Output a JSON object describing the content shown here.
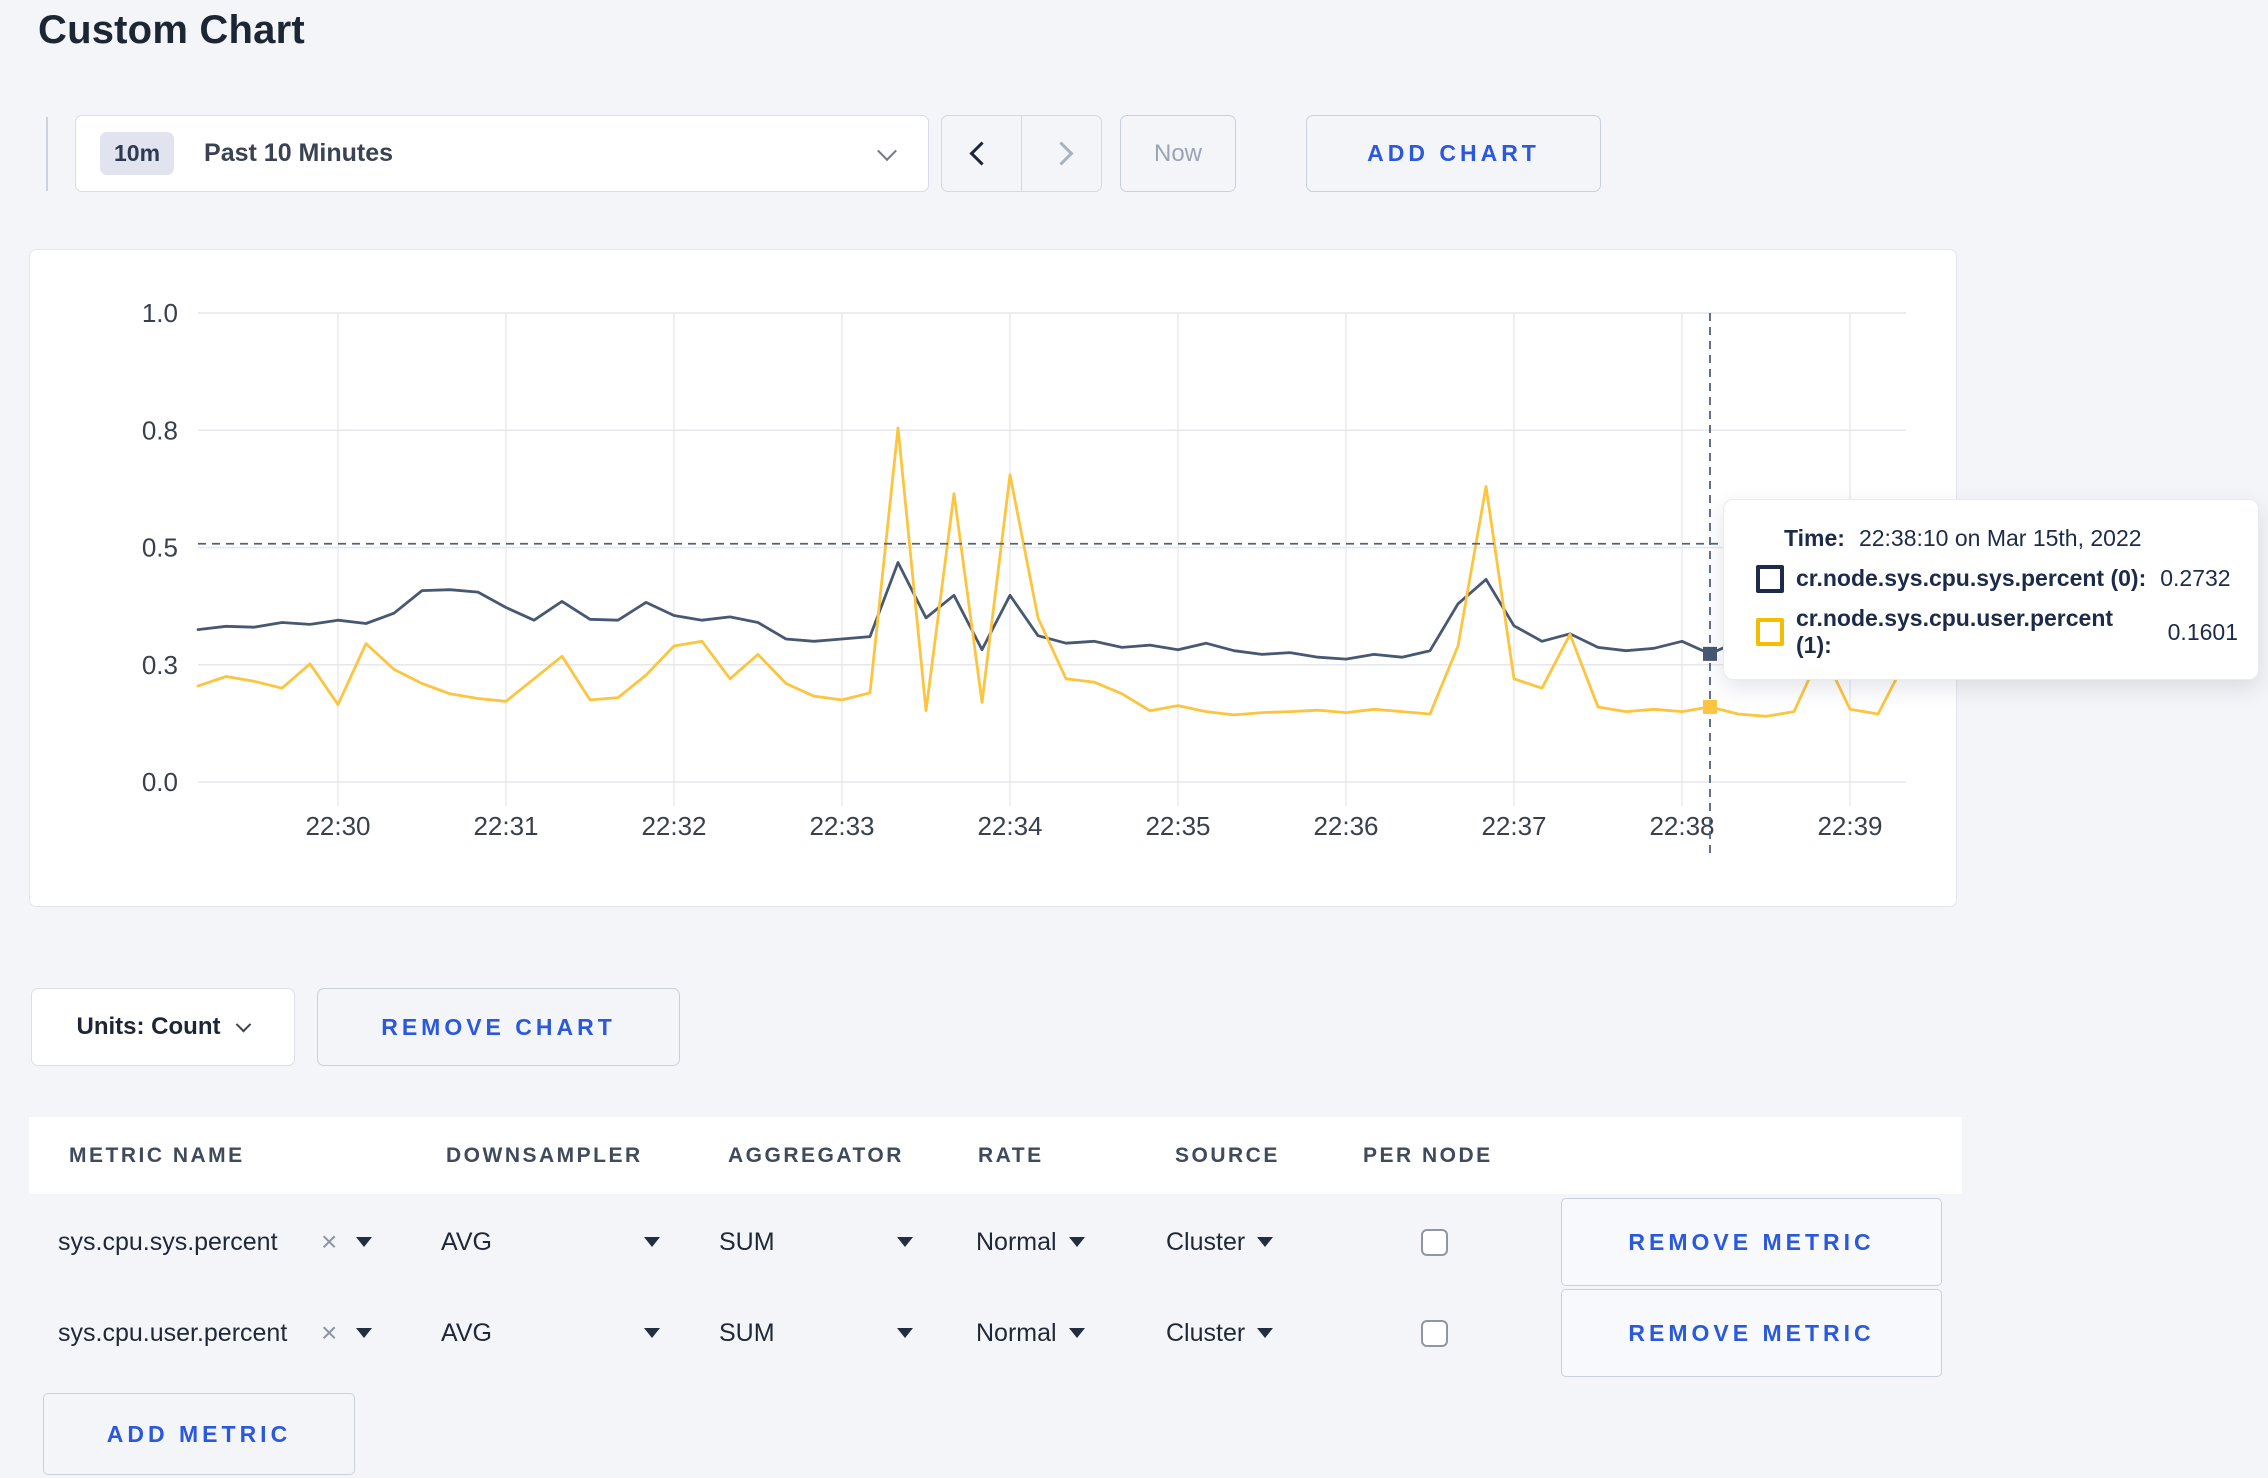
{
  "page": {
    "title": "Custom Chart"
  },
  "colors": {
    "accent_blue": "#2b59dd",
    "page_bg": "#f4f5f8",
    "series_sys": "#475872",
    "series_user": "#fdc53f",
    "legend_sys": "#1c2b4a",
    "legend_user": "#f5bd00"
  },
  "icons": {
    "clear": "×",
    "time_range_chevron": "chevron-down",
    "prev": "chevron-left",
    "next": "chevron-right",
    "units_chevron": "chevron-down",
    "select_caret": "triangle-down"
  },
  "toolbar": {
    "time_range_badge": "10m",
    "time_range_label": "Past 10 Minutes",
    "now_label": "Now",
    "add_chart_label": "ADD CHART"
  },
  "chart_data": {
    "type": "line",
    "title": "",
    "xlabel": "",
    "ylabel": "",
    "ylim": [
      0,
      1
    ],
    "grid": true,
    "legend_position": "tooltip",
    "x_ticks": [
      "22:30",
      "22:31",
      "22:32",
      "22:33",
      "22:34",
      "22:35",
      "22:36",
      "22:37",
      "22:38",
      "22:39"
    ],
    "y_ticks": [
      {
        "label": "0.0",
        "pos": 0
      },
      {
        "label": "0.3",
        "pos": 0.25
      },
      {
        "label": "0.5",
        "pos": 0.5
      },
      {
        "label": "0.8",
        "pos": 0.75
      },
      {
        "label": "1.0",
        "pos": 1
      }
    ],
    "x_start": "22:29:10",
    "sample_interval_seconds": 10,
    "series": [
      {
        "name": "cr.node.sys.cpu.sys.percent",
        "color": "#475872",
        "values": [
          0.325,
          0.332,
          0.33,
          0.34,
          0.336,
          0.345,
          0.338,
          0.36,
          0.408,
          0.41,
          0.405,
          0.372,
          0.345,
          0.385,
          0.347,
          0.345,
          0.383,
          0.355,
          0.345,
          0.352,
          0.34,
          0.305,
          0.3,
          0.305,
          0.31,
          0.468,
          0.35,
          0.398,
          0.282,
          0.398,
          0.312,
          0.296,
          0.3,
          0.287,
          0.292,
          0.282,
          0.296,
          0.28,
          0.272,
          0.276,
          0.266,
          0.262,
          0.272,
          0.266,
          0.28,
          0.38,
          0.432,
          0.333,
          0.3,
          0.316,
          0.287,
          0.28,
          0.285,
          0.3,
          0.2732,
          0.3,
          0.29,
          0.3,
          0.31,
          0.305,
          0.3,
          0.296
        ]
      },
      {
        "name": "cr.node.sys.cpu.user.percent",
        "color": "#fdc53f",
        "values": [
          0.205,
          0.225,
          0.215,
          0.2,
          0.252,
          0.165,
          0.295,
          0.24,
          0.21,
          0.188,
          0.178,
          0.172,
          0.22,
          0.268,
          0.175,
          0.18,
          0.228,
          0.29,
          0.3,
          0.22,
          0.272,
          0.21,
          0.183,
          0.175,
          0.19,
          0.755,
          0.152,
          0.615,
          0.17,
          0.655,
          0.35,
          0.22,
          0.213,
          0.188,
          0.152,
          0.163,
          0.15,
          0.143,
          0.148,
          0.15,
          0.153,
          0.148,
          0.155,
          0.15,
          0.145,
          0.29,
          0.63,
          0.22,
          0.2,
          0.315,
          0.16,
          0.15,
          0.155,
          0.15,
          0.1601,
          0.145,
          0.14,
          0.15,
          0.28,
          0.155,
          0.145,
          0.26
        ]
      }
    ],
    "crosshair": {
      "index": 54,
      "h_value": 0.508
    },
    "hover": {
      "time": "22:38:10 on Mar 15th, 2022",
      "points": [
        {
          "series": 0,
          "value": 0.2732
        },
        {
          "series": 1,
          "value": 0.1601
        }
      ]
    }
  },
  "tooltip": {
    "time_label": "Time:",
    "time_value": "22:38:10 on Mar 15th, 2022",
    "rows": [
      {
        "label": "cr.node.sys.cpu.sys.percent (0):",
        "value": "0.2732"
      },
      {
        "label": "cr.node.sys.cpu.user.percent (1):",
        "value": "0.1601"
      }
    ]
  },
  "chart_controls": {
    "units_label": "Units: Count",
    "remove_chart_label": "REMOVE CHART"
  },
  "metrics": {
    "headers": [
      "METRIC NAME",
      "DOWNSAMPLER",
      "AGGREGATOR",
      "RATE",
      "SOURCE",
      "PER NODE"
    ],
    "rows": [
      {
        "name": "sys.cpu.sys.percent",
        "downsampler": "AVG",
        "aggregator": "SUM",
        "rate": "Normal",
        "source": "Cluster",
        "per_node": false
      },
      {
        "name": "sys.cpu.user.percent",
        "downsampler": "AVG",
        "aggregator": "SUM",
        "rate": "Normal",
        "source": "Cluster",
        "per_node": false
      }
    ],
    "remove_metric_label": "REMOVE METRIC",
    "add_metric_label": "ADD METRIC"
  }
}
